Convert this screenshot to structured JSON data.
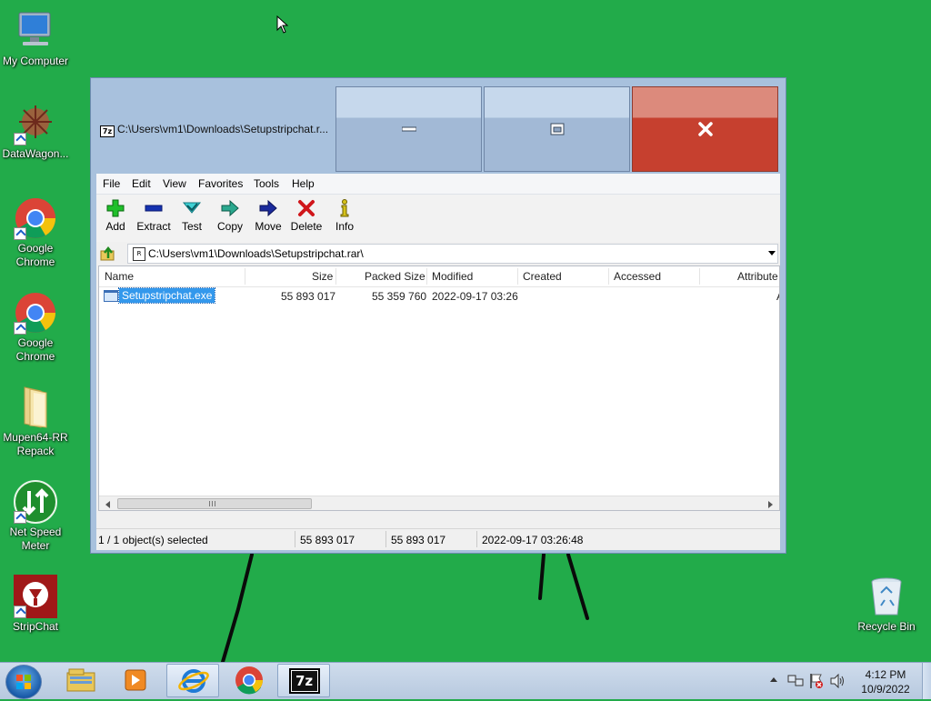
{
  "desktop": {
    "icons": [
      {
        "label": "My Computer",
        "icon": "computer-icon"
      },
      {
        "label": "DataWagon...",
        "icon": "datawagon-icon"
      },
      {
        "label": "Google Chrome",
        "icon": "chrome-icon"
      },
      {
        "label": "Google Chrome",
        "icon": "chrome-icon"
      },
      {
        "label": "Mupen64-RR Repack",
        "icon": "folder-icon"
      },
      {
        "label": "Net Speed Meter",
        "icon": "netspeed-icon"
      },
      {
        "label": "StripChat",
        "icon": "stripchat-icon"
      },
      {
        "label": "Recycle Bin",
        "icon": "recycle-bin-icon"
      }
    ]
  },
  "window": {
    "title": "C:\\Users\\vm1\\Downloads\\Setupstripchat.r...",
    "menu": [
      "File",
      "Edit",
      "View",
      "Favorites",
      "Tools",
      "Help"
    ],
    "toolbar": [
      {
        "label": "Add",
        "icon": "add-icon"
      },
      {
        "label": "Extract",
        "icon": "extract-icon"
      },
      {
        "label": "Test",
        "icon": "test-icon"
      },
      {
        "label": "Copy",
        "icon": "copy-icon"
      },
      {
        "label": "Move",
        "icon": "move-icon"
      },
      {
        "label": "Delete",
        "icon": "delete-icon"
      },
      {
        "label": "Info",
        "icon": "info-icon"
      }
    ],
    "address": "C:\\Users\\vm1\\Downloads\\Setupstripchat.rar\\",
    "columns": [
      "Name",
      "Size",
      "Packed Size",
      "Modified",
      "Created",
      "Accessed",
      "Attribute"
    ],
    "rows": [
      {
        "name": "Setupstripchat.exe",
        "size": "55 893 017",
        "packed": "55 359 760",
        "modified": "2022-09-17 03:26",
        "created": "",
        "accessed": "",
        "attributes": "A"
      }
    ],
    "status": {
      "selection": "1 / 1 object(s) selected",
      "size": "55 893 017",
      "packed": "55 893 017",
      "modified": "2022-09-17 03:26:48"
    }
  },
  "taskbar": {
    "items": [
      {
        "name": "explorer",
        "icon": "explorer-icon"
      },
      {
        "name": "media-player",
        "icon": "media-player-icon"
      },
      {
        "name": "internet-explorer",
        "icon": "ie-icon"
      },
      {
        "name": "chrome",
        "icon": "chrome-icon"
      },
      {
        "name": "7zip",
        "icon": "7zip-icon",
        "label": "7z"
      }
    ],
    "clock": {
      "time": "4:12 PM",
      "date": "10/9/2022"
    }
  },
  "colors": {
    "desktop": "#22ab4a",
    "selection": "#3398ec",
    "close_button": "#c6402f"
  }
}
